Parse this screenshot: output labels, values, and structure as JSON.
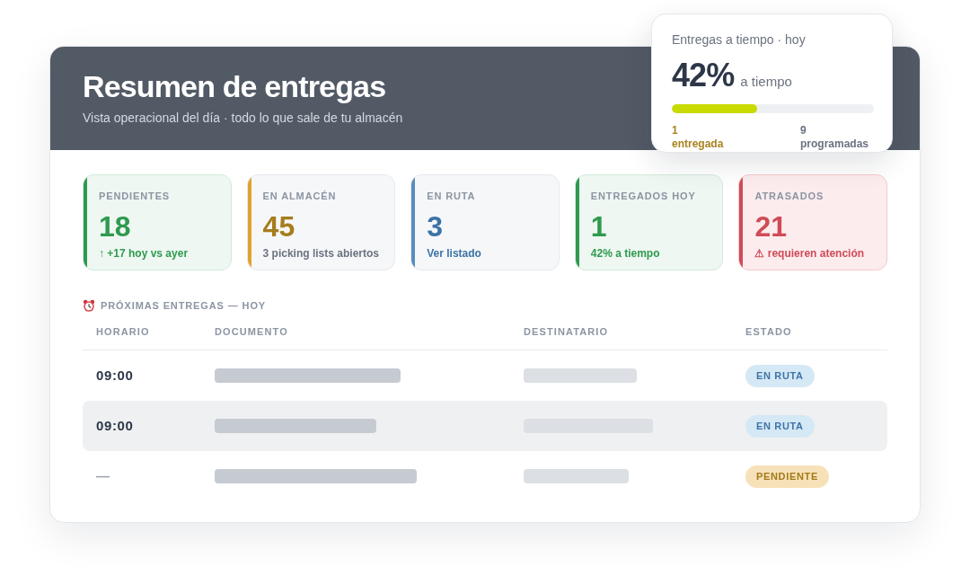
{
  "header": {
    "title": "Resumen de entregas",
    "subtitle": "Vista operacional del día · todo lo que sale de tu almacén"
  },
  "on_time_card": {
    "title": "Entregas a tiempo · hoy",
    "value": "42%",
    "value_label": "a tiempo",
    "level": 0.42,
    "delivered": {
      "count": "1",
      "label": "entregada"
    },
    "scheduled": {
      "count": "9",
      "label": "programadas"
    }
  },
  "kpis": [
    {
      "label": "PENDIENTES",
      "value": "18",
      "note": "↑ +17 hoy vs ayer",
      "kind": "positive",
      "color": "#2e9a4f"
    },
    {
      "label": "EN ALMACÉN",
      "value": "45",
      "note": "3 picking lists abiertos",
      "kind": "warehouse",
      "color": "#e0a32e"
    },
    {
      "label": "EN RUTA",
      "value": "3",
      "note": "Ver listado",
      "kind": "route",
      "color": "#5a8dbd"
    },
    {
      "label": "ENTREGADOS HOY",
      "value": "1",
      "note": "42% a tiempo",
      "kind": "positive",
      "color": "#2e9a4f"
    },
    {
      "label": "ATRASADOS",
      "value": "21",
      "note": "⚠ requieren atención",
      "kind": "alert",
      "color": "#d04b57"
    }
  ],
  "upcoming": {
    "title": "PRÓXIMAS ENTREGAS — HOY",
    "columns": [
      "HORARIO",
      "DOCUMENTO",
      "DESTINATARIO",
      "ESTADO"
    ],
    "rows": [
      {
        "time": "09:00",
        "kind": "scheduled",
        "selected": false,
        "document": {
          "kind": "placeholder"
        },
        "recipient": {
          "kind": "placeholder"
        },
        "status": {
          "label": "EN RUTA",
          "kind": "route"
        }
      },
      {
        "time": "09:00",
        "kind": "scheduled",
        "selected": true,
        "document": {
          "kind": "placeholder"
        },
        "recipient": {
          "kind": "placeholder"
        },
        "status": {
          "label": "EN RUTA",
          "kind": "route"
        }
      },
      {
        "time": "—",
        "kind": "unscheduled",
        "selected": false,
        "document": {
          "kind": "placeholder"
        },
        "recipient": {
          "kind": "placeholder"
        },
        "status": {
          "label": "PENDIENTE",
          "kind": "pending"
        }
      }
    ]
  }
}
